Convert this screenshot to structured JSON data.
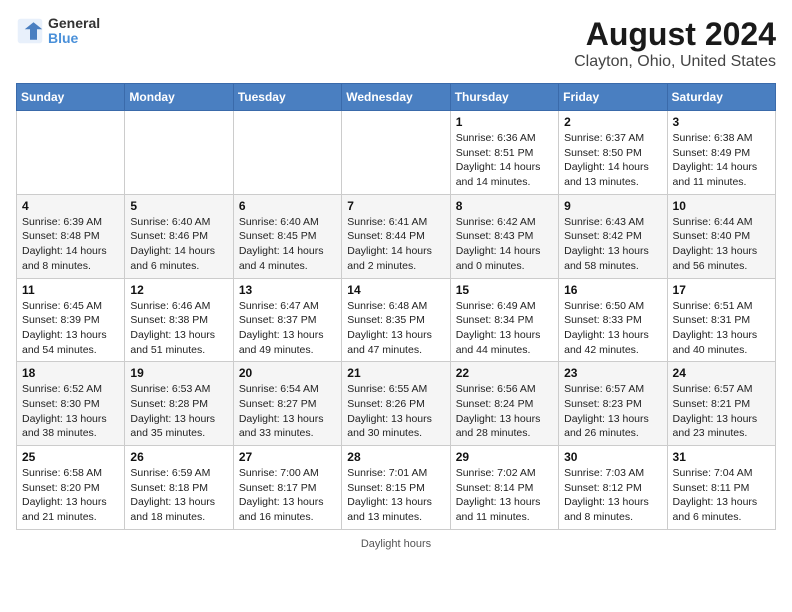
{
  "header": {
    "logo_line1": "General",
    "logo_line2": "Blue",
    "title": "August 2024",
    "subtitle": "Clayton, Ohio, United States"
  },
  "days_of_week": [
    "Sunday",
    "Monday",
    "Tuesday",
    "Wednesday",
    "Thursday",
    "Friday",
    "Saturday"
  ],
  "weeks": [
    [
      {
        "day": "",
        "info": ""
      },
      {
        "day": "",
        "info": ""
      },
      {
        "day": "",
        "info": ""
      },
      {
        "day": "",
        "info": ""
      },
      {
        "day": "1",
        "info": "Sunrise: 6:36 AM\nSunset: 8:51 PM\nDaylight: 14 hours and 14 minutes."
      },
      {
        "day": "2",
        "info": "Sunrise: 6:37 AM\nSunset: 8:50 PM\nDaylight: 14 hours and 13 minutes."
      },
      {
        "day": "3",
        "info": "Sunrise: 6:38 AM\nSunset: 8:49 PM\nDaylight: 14 hours and 11 minutes."
      }
    ],
    [
      {
        "day": "4",
        "info": "Sunrise: 6:39 AM\nSunset: 8:48 PM\nDaylight: 14 hours and 8 minutes."
      },
      {
        "day": "5",
        "info": "Sunrise: 6:40 AM\nSunset: 8:46 PM\nDaylight: 14 hours and 6 minutes."
      },
      {
        "day": "6",
        "info": "Sunrise: 6:40 AM\nSunset: 8:45 PM\nDaylight: 14 hours and 4 minutes."
      },
      {
        "day": "7",
        "info": "Sunrise: 6:41 AM\nSunset: 8:44 PM\nDaylight: 14 hours and 2 minutes."
      },
      {
        "day": "8",
        "info": "Sunrise: 6:42 AM\nSunset: 8:43 PM\nDaylight: 14 hours and 0 minutes."
      },
      {
        "day": "9",
        "info": "Sunrise: 6:43 AM\nSunset: 8:42 PM\nDaylight: 13 hours and 58 minutes."
      },
      {
        "day": "10",
        "info": "Sunrise: 6:44 AM\nSunset: 8:40 PM\nDaylight: 13 hours and 56 minutes."
      }
    ],
    [
      {
        "day": "11",
        "info": "Sunrise: 6:45 AM\nSunset: 8:39 PM\nDaylight: 13 hours and 54 minutes."
      },
      {
        "day": "12",
        "info": "Sunrise: 6:46 AM\nSunset: 8:38 PM\nDaylight: 13 hours and 51 minutes."
      },
      {
        "day": "13",
        "info": "Sunrise: 6:47 AM\nSunset: 8:37 PM\nDaylight: 13 hours and 49 minutes."
      },
      {
        "day": "14",
        "info": "Sunrise: 6:48 AM\nSunset: 8:35 PM\nDaylight: 13 hours and 47 minutes."
      },
      {
        "day": "15",
        "info": "Sunrise: 6:49 AM\nSunset: 8:34 PM\nDaylight: 13 hours and 44 minutes."
      },
      {
        "day": "16",
        "info": "Sunrise: 6:50 AM\nSunset: 8:33 PM\nDaylight: 13 hours and 42 minutes."
      },
      {
        "day": "17",
        "info": "Sunrise: 6:51 AM\nSunset: 8:31 PM\nDaylight: 13 hours and 40 minutes."
      }
    ],
    [
      {
        "day": "18",
        "info": "Sunrise: 6:52 AM\nSunset: 8:30 PM\nDaylight: 13 hours and 38 minutes."
      },
      {
        "day": "19",
        "info": "Sunrise: 6:53 AM\nSunset: 8:28 PM\nDaylight: 13 hours and 35 minutes."
      },
      {
        "day": "20",
        "info": "Sunrise: 6:54 AM\nSunset: 8:27 PM\nDaylight: 13 hours and 33 minutes."
      },
      {
        "day": "21",
        "info": "Sunrise: 6:55 AM\nSunset: 8:26 PM\nDaylight: 13 hours and 30 minutes."
      },
      {
        "day": "22",
        "info": "Sunrise: 6:56 AM\nSunset: 8:24 PM\nDaylight: 13 hours and 28 minutes."
      },
      {
        "day": "23",
        "info": "Sunrise: 6:57 AM\nSunset: 8:23 PM\nDaylight: 13 hours and 26 minutes."
      },
      {
        "day": "24",
        "info": "Sunrise: 6:57 AM\nSunset: 8:21 PM\nDaylight: 13 hours and 23 minutes."
      }
    ],
    [
      {
        "day": "25",
        "info": "Sunrise: 6:58 AM\nSunset: 8:20 PM\nDaylight: 13 hours and 21 minutes."
      },
      {
        "day": "26",
        "info": "Sunrise: 6:59 AM\nSunset: 8:18 PM\nDaylight: 13 hours and 18 minutes."
      },
      {
        "day": "27",
        "info": "Sunrise: 7:00 AM\nSunset: 8:17 PM\nDaylight: 13 hours and 16 minutes."
      },
      {
        "day": "28",
        "info": "Sunrise: 7:01 AM\nSunset: 8:15 PM\nDaylight: 13 hours and 13 minutes."
      },
      {
        "day": "29",
        "info": "Sunrise: 7:02 AM\nSunset: 8:14 PM\nDaylight: 13 hours and 11 minutes."
      },
      {
        "day": "30",
        "info": "Sunrise: 7:03 AM\nSunset: 8:12 PM\nDaylight: 13 hours and 8 minutes."
      },
      {
        "day": "31",
        "info": "Sunrise: 7:04 AM\nSunset: 8:11 PM\nDaylight: 13 hours and 6 minutes."
      }
    ]
  ],
  "footer": "Daylight hours"
}
